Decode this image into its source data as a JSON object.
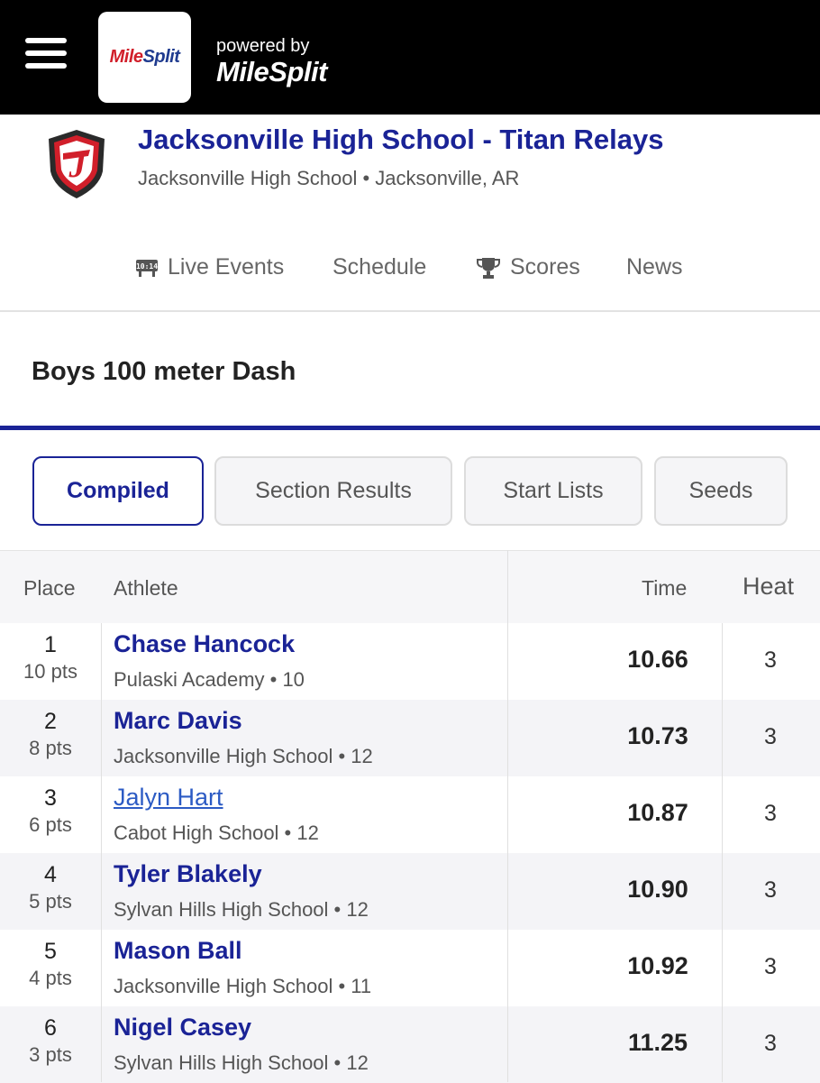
{
  "header": {
    "logo_main": "Mile",
    "logo_split": "Split",
    "powered_by": "powered by",
    "powered_brand": "MileSplit"
  },
  "meet": {
    "title": "Jacksonville High School - Titan Relays",
    "subtitle": "Jacksonville High School • Jacksonville, AR",
    "logo_letter": "J"
  },
  "nav": {
    "live_events": "Live Events",
    "live_icon_text": "10:14",
    "schedule": "Schedule",
    "scores": "Scores",
    "news": "News"
  },
  "event": {
    "title": "Boys 100 meter Dash"
  },
  "tabs": [
    {
      "label": "Compiled",
      "active": true
    },
    {
      "label": "Section Results",
      "active": false
    },
    {
      "label": "Start Lists",
      "active": false
    },
    {
      "label": "Seeds",
      "active": false
    }
  ],
  "table": {
    "headers": {
      "place": "Place",
      "athlete": "Athlete",
      "time": "Time",
      "heat": "Heat"
    },
    "rows": [
      {
        "place": "1",
        "pts": "10 pts",
        "name": "Chase Hancock",
        "school": "Pulaski Academy • 10",
        "time": "10.66",
        "heat": "3"
      },
      {
        "place": "2",
        "pts": "8 pts",
        "name": "Marc Davis",
        "school": "Jacksonville High School • 12",
        "time": "10.73",
        "heat": "3"
      },
      {
        "place": "3",
        "pts": "6 pts",
        "name": "Jalyn Hart",
        "school": "Cabot High School • 12",
        "time": "10.87",
        "heat": "3"
      },
      {
        "place": "4",
        "pts": "5 pts",
        "name": "Tyler Blakely",
        "school": "Sylvan Hills High School • 12",
        "time": "10.90",
        "heat": "3"
      },
      {
        "place": "5",
        "pts": "4 pts",
        "name": "Mason Ball",
        "school": "Jacksonville High School • 11",
        "time": "10.92",
        "heat": "3"
      },
      {
        "place": "6",
        "pts": "3 pts",
        "name": "Nigel Casey",
        "school": "Sylvan Hills High School • 12",
        "time": "11.25",
        "heat": "3"
      }
    ]
  },
  "colors": {
    "brand_navy": "#1a2396",
    "link_blue": "#2c5bc4",
    "logo_red": "#d11f2a"
  }
}
